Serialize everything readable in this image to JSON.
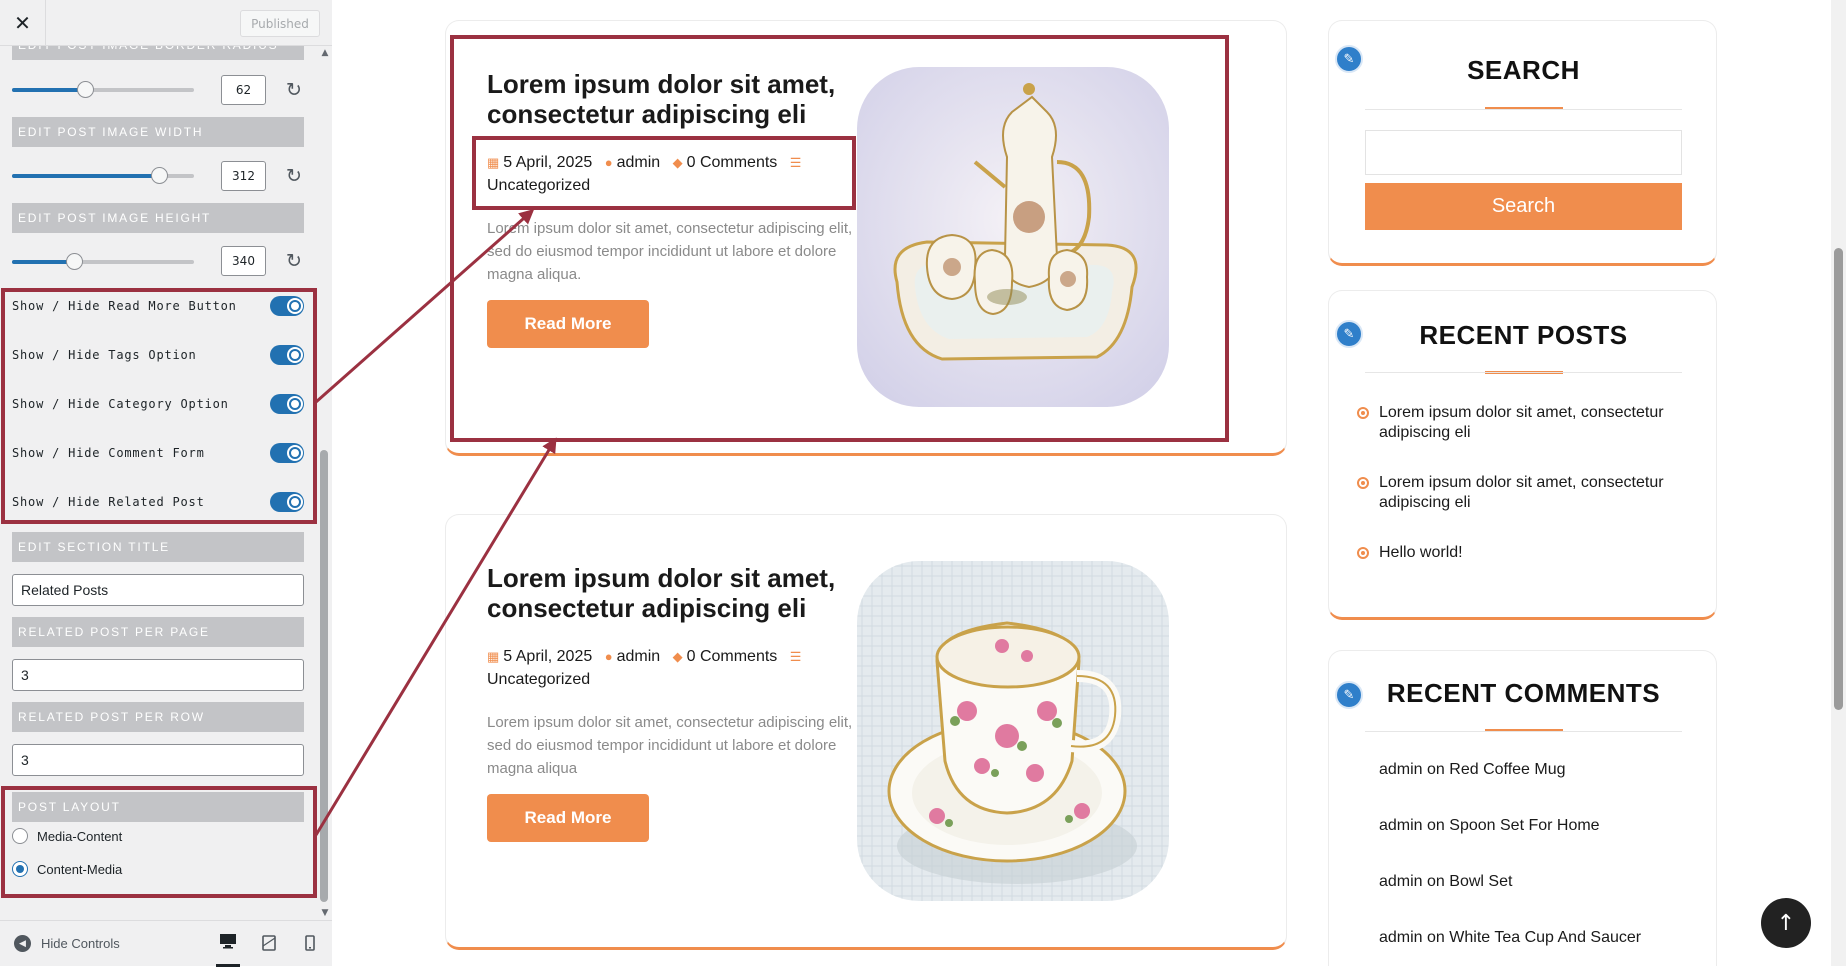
{
  "customizer": {
    "close_icon": "close-icon",
    "publish_label": "Published",
    "cut_heading": "EDIT POST IMAGE BORDER RADIUS",
    "sliders": [
      {
        "id": "radius",
        "value": "62",
        "level_percent": 40
      },
      {
        "id": "width",
        "heading": "EDIT POST IMAGE WIDTH",
        "value": "312",
        "level_percent": 81
      },
      {
        "id": "height",
        "heading": "EDIT POST IMAGE HEIGHT",
        "value": "340",
        "level_percent": 34
      }
    ],
    "toggles": [
      {
        "label": "Show / Hide Read More Button",
        "on": true
      },
      {
        "label": "Show / Hide Tags Option",
        "on": true
      },
      {
        "label": "Show / Hide Category Option",
        "on": true
      },
      {
        "label": "Show / Hide Comment Form",
        "on": true
      },
      {
        "label": "Show / Hide Related Post",
        "on": true
      }
    ],
    "section_title": {
      "heading": "EDIT SECTION TITLE",
      "value": "Related Posts"
    },
    "per_page": {
      "heading": "RELATED POST PER PAGE",
      "value": "3"
    },
    "per_row": {
      "heading": "RELATED POST PER ROW",
      "value": "3"
    },
    "post_layout": {
      "heading": "POST LAYOUT",
      "options": [
        "Media-Content",
        "Content-Media"
      ],
      "selected": "Content-Media"
    },
    "footer": {
      "hide_controls_label": "Hide Controls",
      "devices": [
        "desktop-icon",
        "tablet-icon",
        "mobile-icon"
      ],
      "active_device": "desktop"
    }
  },
  "posts": [
    {
      "title": "Lorem ipsum dolor sit amet, consectetur adipiscing eli",
      "date": "5 April, 2025",
      "author": "admin",
      "comments": "0 Comments",
      "category": "Uncategorized",
      "excerpt": "Lorem ipsum dolor sit amet, consectetur adipiscing elit, sed do eiusmod tempor incididunt ut labore et dolore magna aliqua.",
      "read_more": "Read More",
      "image": "tea-set-photo"
    },
    {
      "title": "Lorem ipsum dolor sit amet, consectetur adipiscing eli",
      "date": "5 April, 2025",
      "author": "admin",
      "comments": "0 Comments",
      "category": "Uncategorized",
      "excerpt": "Lorem ipsum dolor sit amet, consectetur adipiscing elit, sed do eiusmod tempor incididunt ut labore et dolore magna aliqua",
      "read_more": "Read More",
      "image": "teacup-photo"
    }
  ],
  "widgets": {
    "search": {
      "title": "SEARCH",
      "button": "Search",
      "input_value": ""
    },
    "recent_posts": {
      "title": "RECENT POSTS",
      "items": [
        "Lorem ipsum dolor sit amet, consectetur adipiscing eli",
        "Lorem ipsum dolor sit amet, consectetur adipiscing eli",
        "Hello world!"
      ]
    },
    "recent_comments": {
      "title": "RECENT COMMENTS",
      "items": [
        {
          "author": "admin",
          "on": "on",
          "post": "Red Coffee Mug"
        },
        {
          "author": "admin",
          "on": "on",
          "post": "Spoon Set For Home"
        },
        {
          "author": "admin",
          "on": "on",
          "post": "Bowl Set"
        },
        {
          "author": "admin",
          "on": "on",
          "post": "White Tea Cup And Saucer"
        }
      ]
    }
  },
  "colors": {
    "accent": "#f08d4d",
    "wp_blue": "#2271b1",
    "annotation": "#9b3141",
    "pencil_badge": "#2f7fca"
  }
}
